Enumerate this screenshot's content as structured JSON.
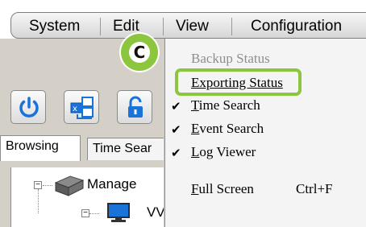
{
  "menubar": {
    "items": [
      "System",
      "Edit",
      "View",
      "Configuration"
    ]
  },
  "tabs": {
    "browsing": "Browsing",
    "time_search": "Time Sear"
  },
  "tree": {
    "root_label": "Manage",
    "child_label": "VV"
  },
  "dropdown": {
    "backup_status": "Backup Status",
    "exporting_status": "Exporting Status",
    "time_search": "Time Search",
    "event_search": "Event Search",
    "log_viewer": "Log Viewer",
    "full_screen": "Full Screen",
    "full_screen_shortcut": "Ctrl+F"
  },
  "badge": {
    "letter": "C"
  },
  "colors": {
    "highlight": "#8cc63f",
    "icon_blue": "#1a73d9"
  },
  "icons": {
    "power": "power-icon",
    "network": "network-icon",
    "lock": "lock-icon",
    "checkmark": "checkmark-icon",
    "device": "device-icon",
    "monitor": "monitor-icon"
  }
}
